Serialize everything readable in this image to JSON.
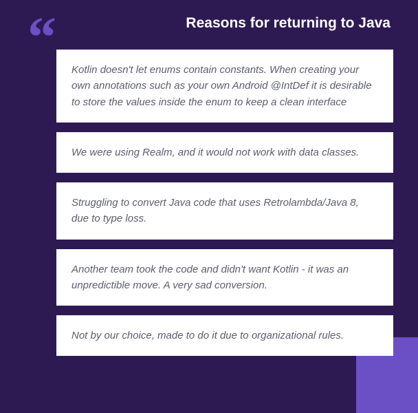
{
  "title": "Reasons for returning to Java",
  "quotes": [
    "Kotlin doesn't let enums contain constants. When creating your own annotations such as your own Android @IntDef it is desirable to store the values inside the enum to keep a clean interface",
    "We were using Realm, and it would not work with data classes.",
    "Struggling to convert Java code that uses Retrolambda/Java 8, due to type loss.",
    "Another team took the code and didn't want Kotlin - it was an unpredictible move. A very sad conversion.",
    "Not by our choice, made to do it due to organizational rules."
  ]
}
